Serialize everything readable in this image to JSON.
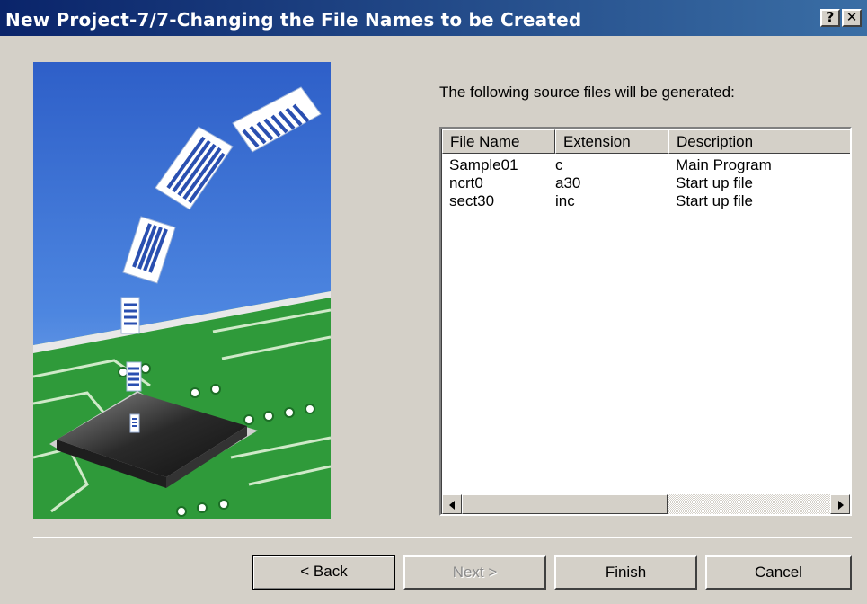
{
  "window": {
    "title": "New Project-7/7-Changing the File Names to be Created",
    "help_label": "?",
    "close_label": "✕"
  },
  "description": "The following source files will be generated:",
  "list": {
    "columns": [
      "File Name",
      "Extension",
      "Description"
    ],
    "rows": [
      {
        "name": "Sample01",
        "ext": "c",
        "desc": "Main Program"
      },
      {
        "name": "ncrt0",
        "ext": "a30",
        "desc": "Start up file"
      },
      {
        "name": "sect30",
        "ext": "inc",
        "desc": "Start up file"
      }
    ]
  },
  "buttons": {
    "back": "< Back",
    "next": "Next >",
    "finish": "Finish",
    "cancel": "Cancel"
  },
  "colors": {
    "title_start": "#0a246a",
    "title_end": "#3a6ea5",
    "dialog_bg": "#d4d0c8",
    "illustration_sky": "#3b6fd0",
    "pcb_green": "#2f9a3a"
  },
  "icons": {
    "help": "help-icon",
    "close": "close-icon",
    "scroll_left": "scroll-left-arrow-icon",
    "scroll_right": "scroll-right-arrow-icon"
  }
}
